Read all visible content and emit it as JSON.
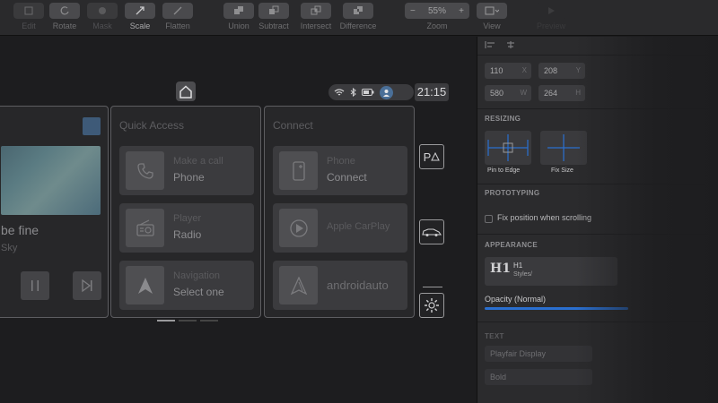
{
  "toolbar": {
    "edit": "Edit",
    "rotate": "Rotate",
    "mask": "Mask",
    "scale": "Scale",
    "flatten": "Flatten",
    "union": "Union",
    "subtract": "Subtract",
    "intersect": "Intersect",
    "difference": "Difference",
    "zoom_value": "55%",
    "zoom_minus": "−",
    "zoom_plus": "+",
    "zoom_label": "Zoom",
    "view_label": "View",
    "preview_label": "Preview"
  },
  "car": {
    "clock": "21:15",
    "media": {
      "song": "be fine",
      "artist": "Sky"
    },
    "quick_access": {
      "title": "Quick Access",
      "tiles": [
        {
          "label": "Make a call",
          "value": "Phone",
          "icon": "phone-icon"
        },
        {
          "label": "Player",
          "value": "Radio",
          "icon": "radio-icon"
        },
        {
          "label": "Navigation",
          "value": "Select one",
          "icon": "navigation-arrow-icon"
        }
      ]
    },
    "connect": {
      "title": "Connect",
      "tiles": [
        {
          "label": "Phone",
          "value": "Connect",
          "icon": "smartphone-icon"
        },
        {
          "label": "Apple CarPlay",
          "value": "",
          "icon": "carplay-icon"
        },
        {
          "label": "",
          "value": "androidauto",
          "icon": "android-auto-icon"
        }
      ]
    },
    "side_buttons": {
      "parking": "P",
      "car_icon": "car-icon",
      "settings_icon": "gear-icon"
    }
  },
  "inspector": {
    "x": "110",
    "x_unit": "X",
    "y": "208",
    "y_unit": "Y",
    "w": "580",
    "w_unit": "W",
    "h": "264",
    "h_unit": "H",
    "resizing_title": "RESIZING",
    "pin_to_edge": "Pin to Edge",
    "fix_size": "Fix Size",
    "prototyping_title": "PROTOTYPING",
    "fix_position": "Fix position when scrolling",
    "appearance_title": "APPEARANCE",
    "style_glyph": "H1",
    "style_name": "H1",
    "style_sub": "Styles/",
    "opacity": "Opacity (Normal)",
    "text_title": "TEXT",
    "font_family": "Playfair Display",
    "font_weight": "Bold"
  },
  "colors": {
    "accent": "#2a6fd0",
    "panel_border": "#5d5d61"
  }
}
